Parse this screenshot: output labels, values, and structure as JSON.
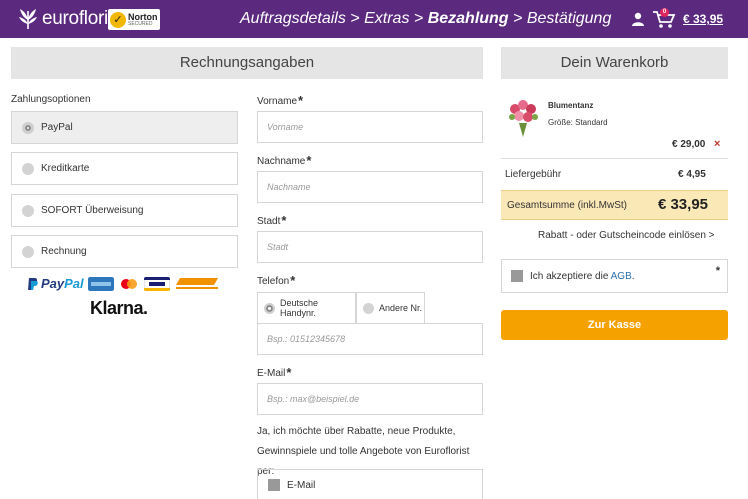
{
  "header": {
    "logo_text": "eurofloristt",
    "norton_label": "Norton",
    "norton_sub": "SECURED",
    "steps": [
      {
        "label": "Auftragsdetails"
      },
      {
        "label": "Extras"
      },
      {
        "label": "Bezahlung"
      },
      {
        "label": "Bestätigung"
      }
    ],
    "step_separator": ">",
    "cart_count": "0",
    "cart_total": "€ 33,95"
  },
  "billing": {
    "title": "Rechnungsangaben",
    "payment_label": "Zahlungsoptionen",
    "payment_options": [
      {
        "label": "PayPal",
        "selected": true
      },
      {
        "label": "Kreditkarte",
        "selected": false
      },
      {
        "label": "SOFORT Überweisung",
        "selected": false
      },
      {
        "label": "Rechnung",
        "selected": false
      }
    ],
    "logos": {
      "paypal_a": "Pay",
      "paypal_b": "Pal",
      "klarna": "Klarna."
    },
    "fields": {
      "firstname_label": "Vorname",
      "firstname_placeholder": "Vorname",
      "lastname_label": "Nachname",
      "lastname_placeholder": "Nachname",
      "city_label": "Stadt",
      "city_placeholder": "Stadt",
      "phone_label": "Telefon",
      "phone_tab_de": "Deutsche Handynr.",
      "phone_tab_other": "Andere Nr.",
      "phone_placeholder": "Bsp.: 01512345678",
      "email_label": "E-Mail",
      "email_placeholder": "Bsp.: max@beispiel.de",
      "required_mark": "*"
    },
    "newsletter_text": "Ja, ich möchte über Rabatte, neue Produkte, Gewinnspiele und tolle Angebote von Euroflorist per:",
    "newsletter_email": "E-Mail"
  },
  "cart": {
    "title": "Dein Warenkorb",
    "product_name": "Blumentanz",
    "product_size": "Größe: Standard",
    "product_price": "€ 29,00",
    "remove": "×",
    "shipping_label": "Liefergebühr",
    "shipping_price": "€ 4,95",
    "total_label": "Gesamtsumme (inkl.MwSt)",
    "total_price": "€ 33,95",
    "voucher_link": "Rabatt - oder Gutscheincode einlösen >",
    "agb_prefix": "Ich akzeptiere die",
    "agb_link": "AGB",
    "agb_suffix": ".",
    "agb_required": "*",
    "checkout_button": "Zur Kasse"
  },
  "colors": {
    "header_bg": "#5b2a7e",
    "checkout_bg": "#f5a100",
    "total_bg": "#fbe8b7",
    "link": "#2a6fb0"
  }
}
